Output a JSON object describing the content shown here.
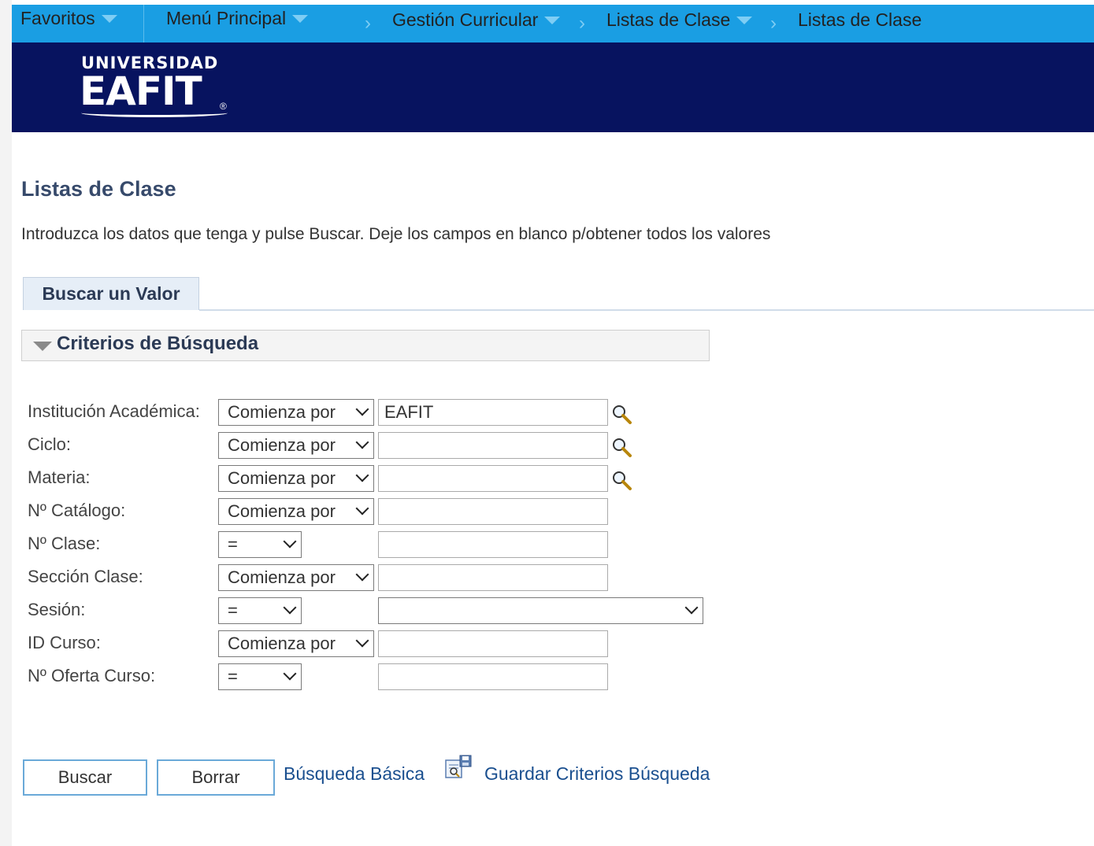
{
  "nav": {
    "favorites": "Favoritos",
    "main_menu": "Menú Principal",
    "breadcrumbs": [
      "Gestión Curricular",
      "Listas de Clase",
      "Listas de Clase"
    ]
  },
  "logo": {
    "line1": "UNIVERSIDAD",
    "line2": "EAFIT",
    "reg": "®"
  },
  "page": {
    "title": "Listas de Clase",
    "instructions": "Introduzca los datos que tenga y pulse Buscar. Deje los campos en blanco p/obtener todos los valores"
  },
  "tab": {
    "label": "Buscar un Valor"
  },
  "section": {
    "title": "Criterios de Búsqueda"
  },
  "fields": [
    {
      "label": "Institución Académica:",
      "operator": "Comienza por",
      "value": "EAFIT"
    },
    {
      "label": "Ciclo:",
      "operator": "Comienza por",
      "value": ""
    },
    {
      "label": "Materia:",
      "operator": "Comienza por",
      "value": ""
    },
    {
      "label": "Nº Catálogo:",
      "operator": "Comienza por",
      "value": ""
    },
    {
      "label": "Nº Clase:",
      "operator": "=",
      "value": ""
    },
    {
      "label": "Sección Clase:",
      "operator": "Comienza por",
      "value": ""
    },
    {
      "label": "Sesión:",
      "operator": "=",
      "value": ""
    },
    {
      "label": "ID Curso:",
      "operator": "Comienza por",
      "value": ""
    },
    {
      "label": "Nº Oferta Curso:",
      "operator": "=",
      "value": ""
    }
  ],
  "actions": {
    "search": "Buscar",
    "clear": "Borrar",
    "basic_search": "Búsqueda Básica",
    "save_criteria": "Guardar Criterios Búsqueda"
  },
  "colors": {
    "nav_bg": "#1a9ee3",
    "banner_bg": "#07135f",
    "title": "#374a6b",
    "link": "#1a4f8f"
  }
}
